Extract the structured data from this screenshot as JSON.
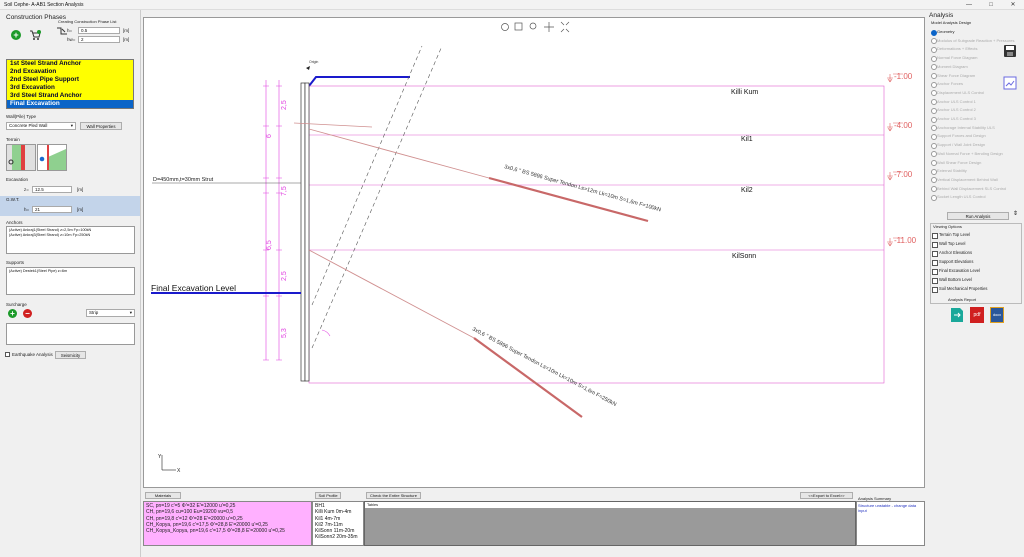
{
  "app": {
    "title": "Soil Cephe- A-AB1 Section Analysis"
  },
  "window": {
    "minimize": "—",
    "maximize": "□",
    "close": "✕"
  },
  "left": {
    "section_title": "Construction Phases",
    "create_label": "Creating Construction Phase List",
    "h_label": "h=",
    "h_value": "0.5",
    "h_unit": "[m]",
    "hw_label": "hw=",
    "hw_value": "2",
    "hw_unit": "[m]",
    "phases": [
      "1st Steel Strand Anchor",
      "2nd Excavation",
      "2nd Steel Pipe Support",
      "3rd Excavation",
      "3rd Steel Strand Anchor",
      "Final Excavation"
    ],
    "selected_phase": 5,
    "wall_type_label": "Wall(Pile) Type",
    "wall_type_value": "Concrete Pled Wall",
    "wall_properties": "Wall Properties",
    "terrain_label": "Terrain",
    "excavation_label": "Excavation",
    "z_label": "z=",
    "z_value": "12.5",
    "z_unit": "[m]",
    "gwt_label": "G.W.T.",
    "gwt_h_label": "h=",
    "gwt_value": "21",
    "gwt_unit": "[m]",
    "anchors_label": "Anchors",
    "anchors": [
      "(Active)  Ankraj1(Steel Strand)  z=2,5m Fp=100kN",
      "(Active)  Ankraj3(Steel Strand)  z=10m Fp=250kN"
    ],
    "supports_label": "Supports",
    "supports": [
      "(Active)  Destek1(Steel Pipe)  z=6m"
    ],
    "surcharge_label": "Surcharge",
    "surcharge_type": "Strip",
    "earthquake_label": "Earthquake Analysis",
    "seismicity": "Seismicity"
  },
  "drawing": {
    "origin_label": "Origin",
    "layers": [
      "Killi Kum",
      "Kil1",
      "Kil2",
      "KilSonn"
    ],
    "right_levels": [
      "-1.00",
      "-4.00",
      "-7.00",
      "-11.00"
    ],
    "dims_left": [
      "2,5",
      "6",
      "7,5",
      "6,5",
      "2,5",
      "5,3"
    ],
    "strut_label": "D=450mm,t=30mm Strut",
    "anchor1_label": "3x0,6 \" BS 5896 Super Tendon Ls=12m Lk=10m S=1,6m F=100kN",
    "anchor2_label": "3x0,6 \" BS 5896 Super Tendon Ls=10m Lk=10m S=1,6m F=250kN",
    "final_exc_label": "Final Excavation Level",
    "axis_y": "Y",
    "axis_x": "X",
    "colors": {
      "magenta": "#e040e0",
      "anchor": "#d09090",
      "wall": "#1a1acc",
      "level": "#e06060"
    }
  },
  "right": {
    "title": "Analysis",
    "subtitle": "Model Analysis Design",
    "items": [
      "Geometry",
      "Modulus of Subgrade Reaction + Pressures",
      "Deformations + Effects",
      "Normal Force Diagram",
      "Moment Diagram",
      "Shear Force Diagram",
      "Anchor Forces",
      "Displacement ULS Control",
      "Anchor ULS Control 1",
      "Anchor ULS Control 2",
      "Anchor ULS Control 3",
      "Anchorage Internal Stability ULS",
      "Support Forces and Design",
      "Support / Wall Joint Design",
      "Wall Normal Force + Bending Design",
      "Wall Shear Force Design",
      "External Stability",
      "Vertical Displacement Behind Wall",
      "Behind Wall Displacement SLS Control",
      "Socket Length ULS Control"
    ],
    "run": "Run Analysis",
    "viewing_title": "Viewing Options",
    "viewing": [
      "Terrain Top Level",
      "Wall Top Level",
      "Anchor Elevations",
      "Support Elevations",
      "Final Excavation Level",
      "Wall Bottom Level",
      "Soil Mechanical Properties"
    ],
    "report_title": "Analysis Report",
    "pdf": "pdf",
    "docx": "docx"
  },
  "bottom": {
    "materials_btn": "Materials",
    "soil_profile_btn": "Soil Profile",
    "check_btn": "Check the Entire Structure",
    "export_btn": "<<Export to Excel>>",
    "materials": [
      "SC, pn=19 c'=5 Φ'=32 E'=12000 u'=0,25",
      "CH, pn=19,6 cu=100 Eu=19200 vu=0,5",
      "CH, pn=19,8 c'=12 Φ'=28 E'=20000 u'=0,25",
      "CH_Kopya, pn=19,6 c'=17,5 Φ'=28,8 E'=20000 u'=0,25",
      "CH_Kopya_Kopya, pn=19,6 c'=17,5 Φ'=28,8 E'=20000 u'=0,25"
    ],
    "soil": [
      "BH1",
      "Killi Kum 0m-4m",
      "Kil1 4m-7m",
      "Kil2 7m-11m",
      "KilSonn 11m-20m",
      "KilSonn2 20m-35m"
    ],
    "tables_label": "Tables",
    "summary_title": "Analysis Summary",
    "summary_text": "Structure unstable - change data input"
  }
}
